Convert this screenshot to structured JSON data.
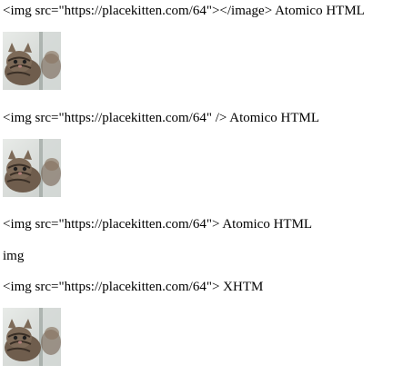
{
  "blocks": [
    {
      "caption": "<img src=\"https://placekitten.com/64\"></image> Atomico HTML",
      "image_alt": "kitten photo"
    },
    {
      "caption": "<img src=\"https://placekitten.com/64\" /> Atomico HTML",
      "image_alt": "kitten photo"
    },
    {
      "caption": "<img src=\"https://placekitten.com/64\"> Atomico HTML",
      "image_alt": null
    },
    {
      "caption": "img",
      "image_alt": null
    },
    {
      "caption": "<img src=\"https://placekitten.com/64\"> XHTM",
      "image_alt": "kitten photo"
    }
  ]
}
